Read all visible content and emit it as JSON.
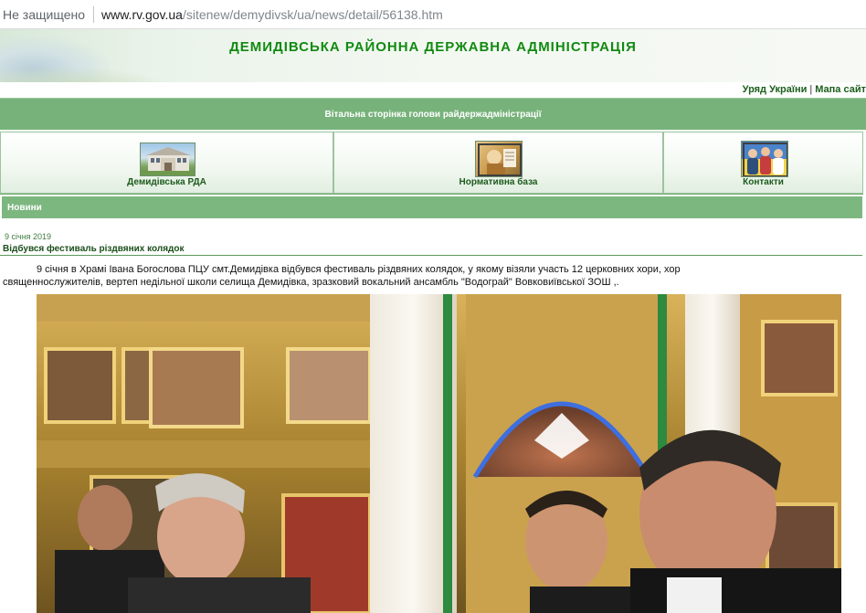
{
  "browser": {
    "security_label": "Не защищено",
    "url_host": "www.rv.gov.ua",
    "url_path": "/sitenew/demydivsk/ua/news/detail/56138.htm"
  },
  "header": {
    "title": "ДЕМИДІВСЬКА РАЙОННА ДЕРЖАВНА АДМІНІСТРАЦІЯ",
    "links": [
      "Уряд України",
      "Мапа сайт"
    ],
    "separator": "|"
  },
  "welcome_bar": {
    "label": "Вітальна сторінка голови райдержадміністрації"
  },
  "nav_icons": [
    {
      "label": "Демидівська РДА",
      "icon": "building-photo-icon"
    },
    {
      "label": "Нормативна база",
      "icon": "documents-photo-icon"
    },
    {
      "label": "Контакти",
      "icon": "contacts-people-icon"
    }
  ],
  "section": {
    "label": "Новини"
  },
  "news": {
    "date": "9 січня 2019",
    "title": "Відбувся фестиваль різдвяних колядок",
    "body_line1": "9 січня  в Храмі Івана Богослова ПЦУ  смт.Демидівка відбувся фестиваль різдвяних колядок,  у якому візяли  участь 12  церковних хори, хор",
    "body_line2": "священнослужителів, вертеп недільної школи селища Демидівка, зразковий вокальний ансамбль \"Водограй\" Вовковиївської ЗОШ ,."
  },
  "colors": {
    "header_green": "#118a11",
    "bar_green": "#77b27a",
    "section_green": "#7db780"
  }
}
